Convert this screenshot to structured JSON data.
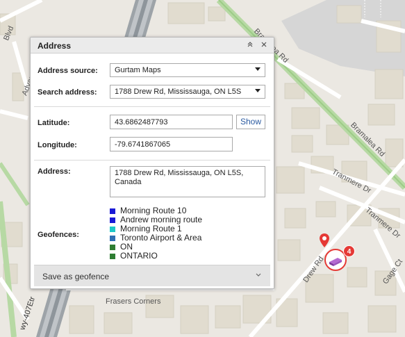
{
  "panel": {
    "title": "Address",
    "address_source": {
      "label": "Address source:",
      "value": "Gurtam Maps"
    },
    "search_address": {
      "label": "Search address:",
      "value": "1788 Drew Rd, Mississauga, ON L5S"
    },
    "latitude": {
      "label": "Latitude:",
      "value": "43.6862487793"
    },
    "show_label": "Show",
    "longitude": {
      "label": "Longitude:",
      "value": "-79.6741867065"
    },
    "address": {
      "label": "Address:",
      "value": "1788 Drew Rd, Mississauga, ON L5S, Canada"
    },
    "geofences": {
      "label": "Geofences:",
      "items": [
        {
          "name": "Morning Route 10",
          "color": "#1a1ad6"
        },
        {
          "name": "Andrew morning route",
          "color": "#1a1ad6"
        },
        {
          "name": "Morning Route 1",
          "color": "#1ec8c8"
        },
        {
          "name": "Toronto Airport & Area",
          "color": "#2f6fb3"
        },
        {
          "name": "ON",
          "color": "#2e7d32"
        },
        {
          "name": "ONTARIO",
          "color": "#2e7d32"
        }
      ]
    },
    "save_as_geofence": "Save as geofence"
  },
  "map": {
    "labels": {
      "bramalea_rd": "Bramalea Rd",
      "bramalea_rd_2": "Bramalea Rd",
      "tranmere_dr": "Tranmere Dr",
      "tranmere_dr_2": "Tranmere Dr",
      "drew_rd": "Drew Rd",
      "gage_ct": "Gage Ct",
      "frasers_corners": "Frasers Corners",
      "advance_blvd": "Advance Blvd",
      "blvd": "Blvd",
      "hwy": "wy-407Etr"
    },
    "unit_count": "4",
    "accent": "#e53935"
  }
}
